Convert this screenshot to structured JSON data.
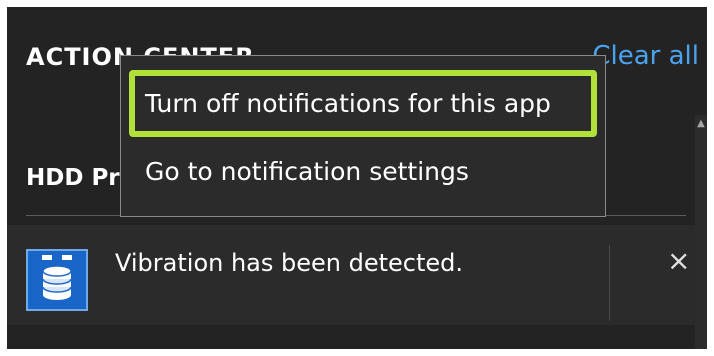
{
  "action_center": {
    "title": "ACTION CENTER",
    "clear_all_label": "Clear all"
  },
  "group": {
    "header": "HDD Protection"
  },
  "notification": {
    "icon": "hdd-stack-icon",
    "text": "Vibration has been detected.",
    "close_label": "×"
  },
  "context_menu": {
    "items": [
      {
        "label": "Turn off notifications for this app",
        "highlighted": true
      },
      {
        "label": "Go to notification settings",
        "highlighted": false
      }
    ],
    "highlight_color": "#b2e23a"
  },
  "colors": {
    "background": "#232323",
    "card": "#2b2b2b",
    "link": "#4aa3ee",
    "icon_tile": "#1a66c8"
  }
}
